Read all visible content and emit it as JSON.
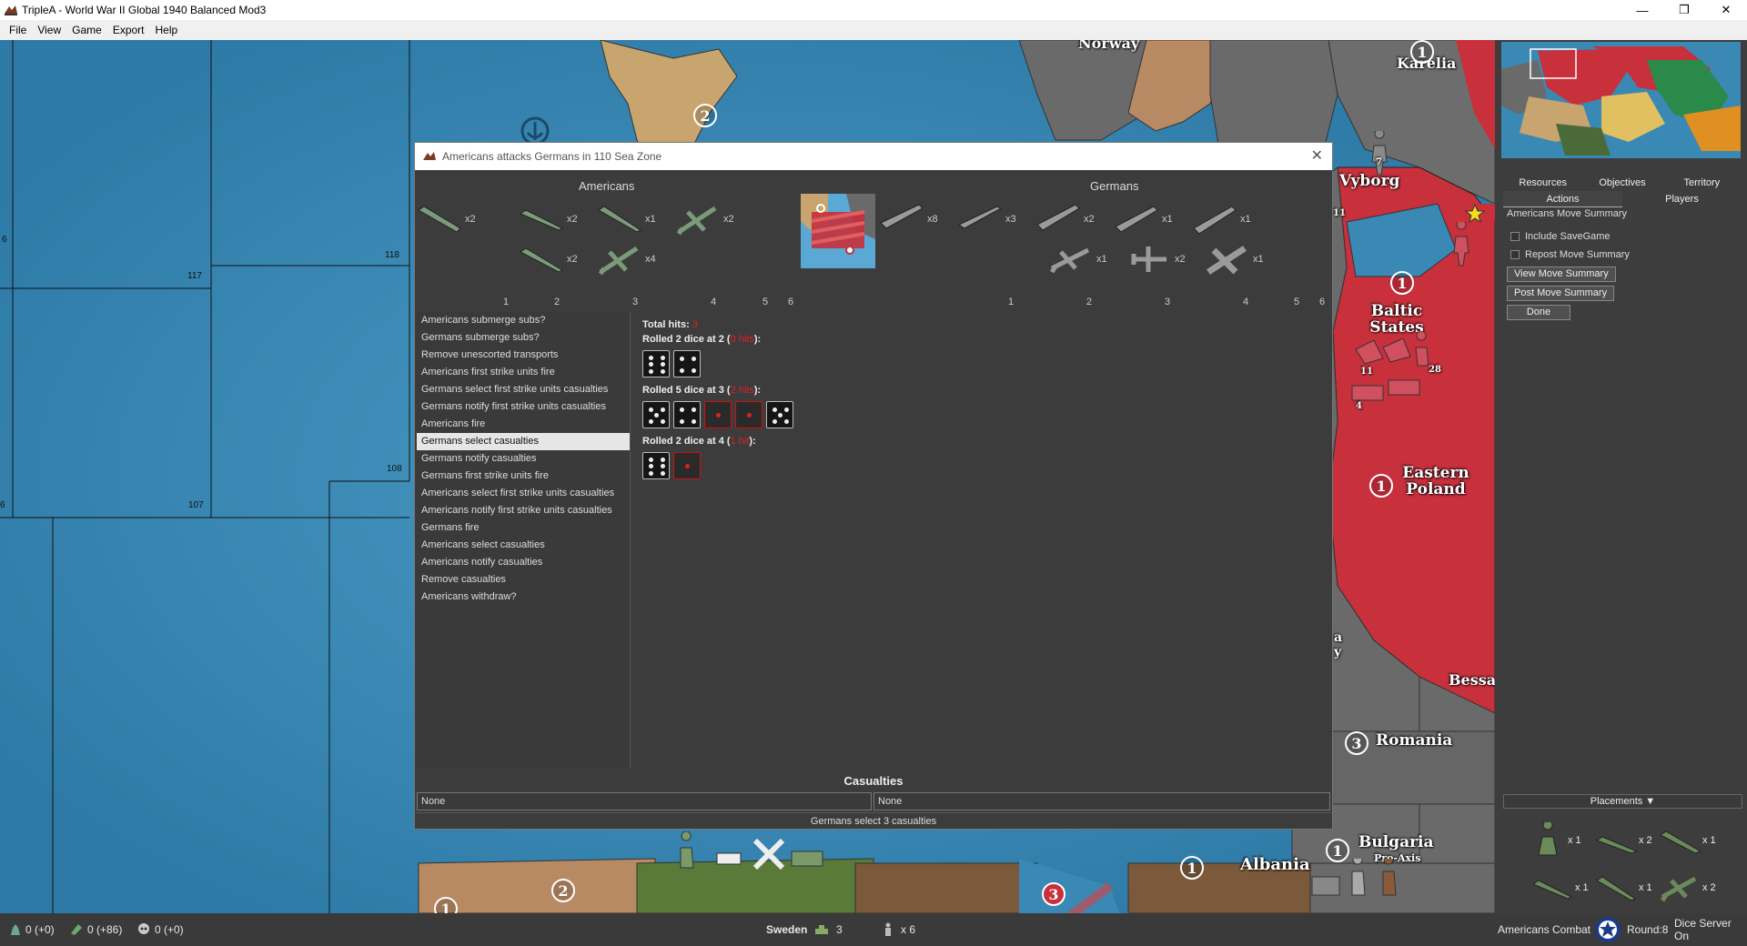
{
  "window": {
    "title": "TripleA - World War II Global 1940 Balanced Mod3",
    "minimize": "—",
    "restore": "❐",
    "close": "✕"
  },
  "menu": [
    "File",
    "View",
    "Game",
    "Export",
    "Help"
  ],
  "map": {
    "labels": {
      "norway": "Norway",
      "karelia": "Karelia",
      "vyborg": "Vyborg",
      "baltic": "Baltic States",
      "eastern_poland": "Eastern Poland",
      "romania": "Romania",
      "bessa": "Bessa",
      "albania": "Albania",
      "bulgaria": "Bulgaria",
      "pro_axis": "Pro-Axis",
      "partial_a": "a",
      "partial_y": "y"
    },
    "zones": {
      "z117": "117",
      "z118": "118",
      "z108": "108",
      "z107": "107",
      "z6a": "6",
      "z6b": "6"
    },
    "tokens": {
      "t2a": "2",
      "t1a": "1",
      "t1b": "1",
      "t1c": "1",
      "t3": "3",
      "t1d": "1",
      "t1e": "1",
      "t2b": "2",
      "t3b": "3",
      "t1f": "1",
      "t7": "7",
      "t11": "11",
      "t28": "28",
      "t4": "4",
      "t11b": "11"
    },
    "colors": {
      "sea": "#3a88b4",
      "soviet": "#c8303c",
      "axis_grey": "#6a6a6a",
      "neutral_tan": "#b78a63",
      "uk_tan": "#c8a46e"
    }
  },
  "battle": {
    "title": "Americans attacks Germans in 110 Sea Zone",
    "close": "✕",
    "attacker": "Americans",
    "defender": "Germans",
    "attacker_units": [
      {
        "icon": "carrier-icon",
        "count": "x2"
      },
      {
        "icon": "submarine-icon",
        "count": "x2"
      },
      {
        "icon": "cruiser-icon",
        "count": "x1"
      },
      {
        "icon": "fighter-icon",
        "count": "x2"
      },
      {
        "icon": "destroyer-icon",
        "count": "x2"
      },
      {
        "icon": "fighter-icon",
        "count": "x4"
      }
    ],
    "defender_units": [
      {
        "icon": "transport-icon",
        "count": "x8"
      },
      {
        "icon": "submarine-icon",
        "count": "x3"
      },
      {
        "icon": "destroyer-icon",
        "count": "x2"
      },
      {
        "icon": "cruiser-icon",
        "count": "x1"
      },
      {
        "icon": "battleship-icon",
        "count": "x1"
      },
      {
        "icon": "fighter-icon",
        "count": "x1"
      },
      {
        "icon": "tactical-bomber-icon",
        "count": "x2"
      },
      {
        "icon": "bomber-icon",
        "count": "x1"
      }
    ],
    "columns": [
      "1",
      "2",
      "3",
      "4",
      "5",
      "6"
    ],
    "steps": [
      "Americans submerge subs?",
      "Germans submerge subs?",
      "Remove unescorted transports",
      "Americans first strike units fire",
      "Germans select first strike units casualties",
      "Germans notify first strike units casualties",
      "Americans fire",
      "Germans select casualties",
      "Germans notify casualties",
      "Germans first strike units fire",
      "Americans select first strike units casualties",
      "Americans notify first strike units casualties",
      "Germans fire",
      "Americans select casualties",
      "Americans notify casualties",
      "Remove casualties",
      "Americans withdraw?"
    ],
    "selected_step": 7,
    "total_hits_label": "Total hits:",
    "total_hits": "3",
    "rolls": [
      {
        "pre": "Rolled 2 dice at 2 (",
        "hits": "0 hits",
        "post": "):",
        "dice": [
          6,
          4
        ],
        "hits_mask": [
          0,
          0
        ]
      },
      {
        "pre": "Rolled 5 dice at 3 (",
        "hits": "2 hits",
        "post": "):",
        "dice": [
          5,
          4,
          1,
          1,
          5
        ],
        "hits_mask": [
          0,
          0,
          1,
          1,
          0
        ]
      },
      {
        "pre": "Rolled 2 dice at 4 (",
        "hits": "1 hit",
        "post": "):",
        "dice": [
          6,
          1
        ],
        "hits_mask": [
          0,
          1
        ]
      }
    ],
    "casualties_header": "Casualties",
    "casualties_left": "None",
    "casualties_right": "None",
    "status": "Germans select 3 casualties"
  },
  "right": {
    "tabs_row1": [
      "Resources",
      "Objectives",
      "Territory"
    ],
    "tabs_row2": [
      "Actions",
      "Players"
    ],
    "panel_title": "Americans Move Summary",
    "include_savegame": "Include SaveGame",
    "repost": "Repost Move Summary",
    "view_btn": "View Move Summary",
    "post_btn": "Post Move Summary",
    "done_btn": "Done",
    "placements": "Placements ▼",
    "placement_units": [
      {
        "icon": "infantry-icon",
        "count": "x 1"
      },
      {
        "icon": "transport-icon",
        "count": "x 2"
      },
      {
        "icon": "battleship-icon",
        "count": "x 1"
      },
      {
        "icon": "submarine-icon",
        "count": "x 1"
      },
      {
        "icon": "destroyer-icon",
        "count": "x 1"
      },
      {
        "icon": "fighter-icon",
        "count": "x 2"
      }
    ]
  },
  "status": {
    "pu": "0 (+0)",
    "income": "0 (+86)",
    "tech": "0 (+0)",
    "territory": "Sweden",
    "territory_units": "3",
    "units_count": "x 6",
    "player": "Americans",
    "phase": "Combat",
    "round": "Round:8",
    "dice": "Dice Server On"
  }
}
